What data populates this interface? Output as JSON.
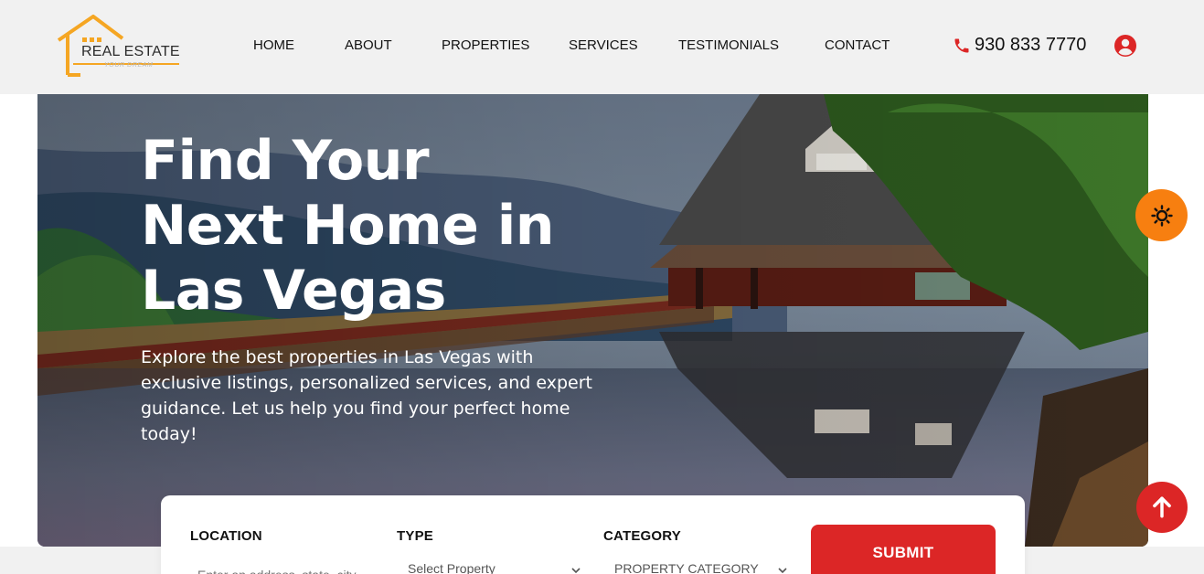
{
  "brand": {
    "name": "REAL ESTATE",
    "tagline": "YOUR DREAM",
    "accent_color": "#f5a623"
  },
  "nav": {
    "items": [
      {
        "label": "HOME"
      },
      {
        "label": "ABOUT"
      },
      {
        "label": "PROPERTIES"
      },
      {
        "label": "SERVICES"
      },
      {
        "label": "TESTIMONIALS"
      },
      {
        "label": "CONTACT"
      }
    ]
  },
  "contact": {
    "phone": "930 833 7770",
    "phone_icon": "phone-icon"
  },
  "user": {
    "icon": "user-circle-icon"
  },
  "hero": {
    "title": "Find Your Next Home in Las Vegas",
    "description": "Explore the best properties in Las Vegas with exclusive listings, personalized services, and expert guidance. Let us help you find your perfect home today!"
  },
  "search": {
    "location_label": "LOCATION",
    "location_placeholder": "Enter an address, state, city",
    "type_label": "TYPE",
    "type_value": "Select Property",
    "category_label": "CATEGORY",
    "category_value": "PROPERTY CATEGORY",
    "submit_label": "SUBMIT"
  },
  "floating": {
    "theme_icon": "sun-icon",
    "scroll_top_icon": "arrow-up-icon"
  },
  "colors": {
    "primary_red": "#dc2626",
    "theme_orange": "#f77f10",
    "header_bg": "#f1f1f1"
  }
}
